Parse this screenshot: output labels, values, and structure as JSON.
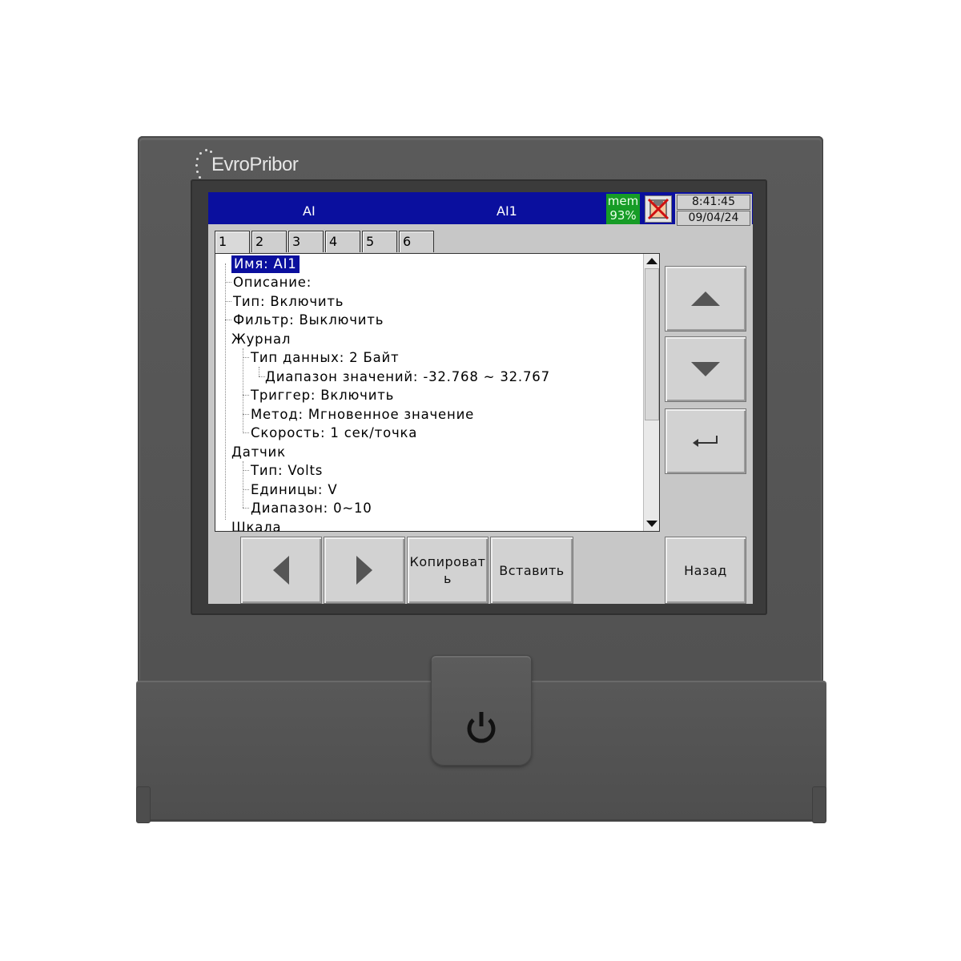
{
  "brand": "EvroPribor",
  "titlebar": {
    "section": "AI",
    "channel": "AI1",
    "mem_label": "mem",
    "mem_percent": "93%",
    "time": "8:41:45",
    "date": "09/04/24"
  },
  "tabs": [
    "1",
    "2",
    "3",
    "4",
    "5",
    "6"
  ],
  "tree": {
    "name": "Имя: AI1",
    "description": "Описание:",
    "type": "Тип: Включить",
    "filter": "Фильтр: Выключить",
    "log": {
      "label": "Журнал",
      "data_type": "Тип данных: 2 Байт",
      "value_range": "Диапазон значений: -32.768 ~ 32.767",
      "trigger": "Триггер: Включить",
      "method": "Метод: Мгновенное значение",
      "speed": "Скорость: 1 сек/точка"
    },
    "sensor": {
      "label": "Датчик",
      "type": "Тип: Volts",
      "units": "Единицы: V",
      "range": "Диапазон: 0~10"
    },
    "scale": "Шкала"
  },
  "buttons": {
    "copy": "Копироват ь",
    "paste": "Вставить",
    "back": "Назад"
  },
  "colors": {
    "titlebar": "#0a0f9e",
    "mem": "#169c26",
    "housing": "#555555"
  }
}
